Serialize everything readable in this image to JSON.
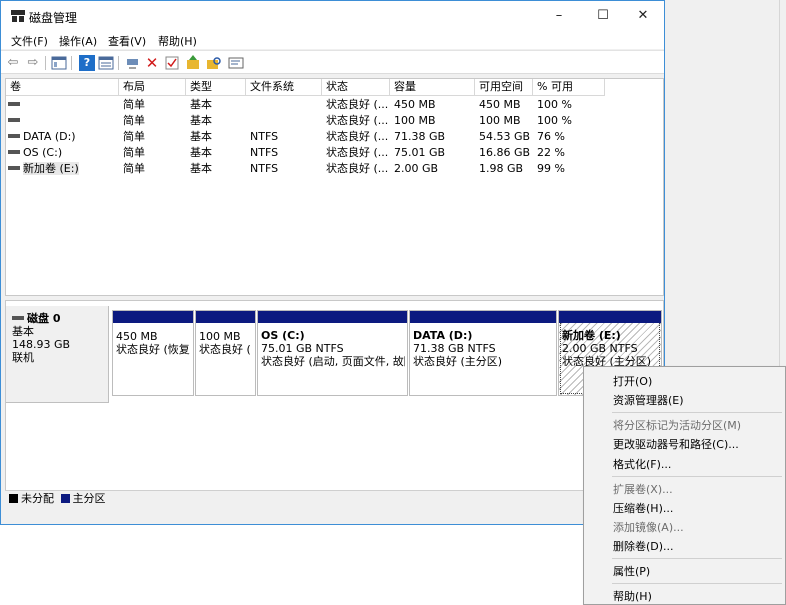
{
  "window": {
    "title": "磁盘管理",
    "minimize": "–",
    "maximize": "☐",
    "close": "✕"
  },
  "menu": [
    "文件(F)",
    "操作(A)",
    "查看(V)",
    "帮助(H)"
  ],
  "toolbar": {
    "icons": [
      "back-arrow-icon",
      "forward-arrow-icon",
      "console-tree-icon",
      "help-icon",
      "view-icon",
      "connect-icon",
      "delete-icon",
      "checkbox-icon",
      "folder-up-icon",
      "search-folder-icon",
      "properties-icon"
    ],
    "glyphs": {
      "back": "⇦",
      "forward": "⇨",
      "delete": "✕",
      "help": "?"
    },
    "colors": {
      "delete": "#d11a1a",
      "help": "#1e6ec8",
      "folder": "#e8b630"
    }
  },
  "columns": [
    "卷",
    "布局",
    "类型",
    "文件系统",
    "状态",
    "容量",
    "可用空间",
    "% 可用"
  ],
  "volumes": [
    {
      "name": "",
      "layout": "简单",
      "type": "基本",
      "fs": "",
      "status": "状态良好 (...",
      "capacity": "450 MB",
      "free": "450 MB",
      "pct": "100 %"
    },
    {
      "name": "",
      "layout": "简单",
      "type": "基本",
      "fs": "",
      "status": "状态良好 (...",
      "capacity": "100 MB",
      "free": "100 MB",
      "pct": "100 %"
    },
    {
      "name": "DATA (D:)",
      "layout": "简单",
      "type": "基本",
      "fs": "NTFS",
      "status": "状态良好 (...",
      "capacity": "71.38 GB",
      "free": "54.53 GB",
      "pct": "76 %"
    },
    {
      "name": "OS (C:)",
      "layout": "简单",
      "type": "基本",
      "fs": "NTFS",
      "status": "状态良好 (...",
      "capacity": "75.01 GB",
      "free": "16.86 GB",
      "pct": "22 %"
    },
    {
      "name": "新加卷 (E:)",
      "layout": "简单",
      "type": "基本",
      "fs": "NTFS",
      "status": "状态良好 (...",
      "capacity": "2.00 GB",
      "free": "1.98 GB",
      "pct": "99 %"
    }
  ],
  "disk": {
    "title": "磁盘 0",
    "type": "基本",
    "size": "148.93 GB",
    "state": "联机"
  },
  "partitions": [
    {
      "name": "",
      "size_fs": "450 MB",
      "status": "状态良好 (恢复"
    },
    {
      "name": "",
      "size_fs": "100 MB",
      "status": "状态良好 ("
    },
    {
      "name": "OS  (C:)",
      "size_fs": "75.01 GB NTFS",
      "status": "状态良好 (启动, 页面文件, 故障"
    },
    {
      "name": "DATA  (D:)",
      "size_fs": "71.38 GB NTFS",
      "status": "状态良好 (主分区)"
    },
    {
      "name": "新加卷  (E:)",
      "size_fs": "2.00 GB NTFS",
      "status": "状态良好 (主分区)"
    }
  ],
  "legend": {
    "unallocated": "未分配",
    "primary": "主分区",
    "unallocated_color": "#000000",
    "primary_color": "#0c1a80"
  },
  "context_menu": {
    "open": "打开(O)",
    "explorer": "资源管理器(E)",
    "mark_active": "将分区标记为活动分区(M)",
    "change_letter": "更改驱动器号和路径(C)...",
    "format": "格式化(F)...",
    "extend": "扩展卷(X)...",
    "shrink": "压缩卷(H)...",
    "add_mirror": "添加镜像(A)...",
    "delete": "删除卷(D)...",
    "properties": "属性(P)",
    "help": "帮助(H)"
  }
}
